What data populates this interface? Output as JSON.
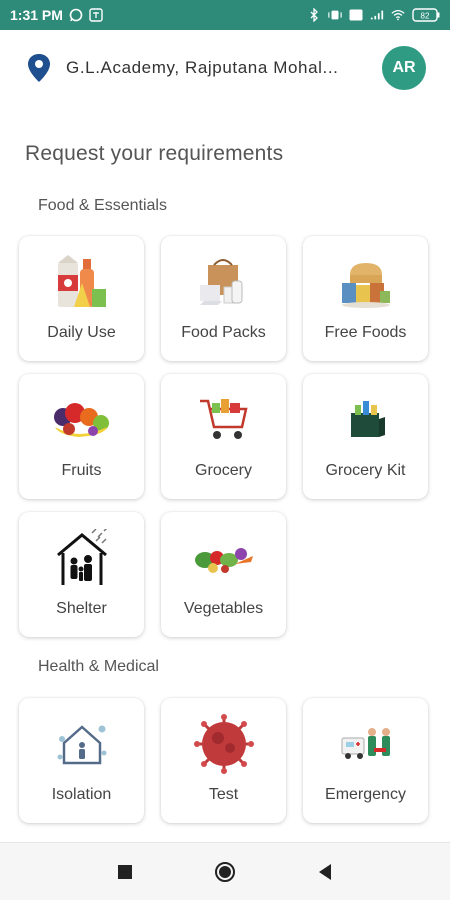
{
  "status": {
    "time": "1:31 PM",
    "battery": "82"
  },
  "header": {
    "location": "G.L.Academy, Rajputana Mohal...",
    "avatar_initials": "AR"
  },
  "page": {
    "title": "Request your requirements"
  },
  "sections": [
    {
      "label": "Food & Essentials",
      "items": [
        {
          "label": "Daily Use",
          "icon": "daily-use-icon"
        },
        {
          "label": "Food Packs",
          "icon": "food-packs-icon"
        },
        {
          "label": "Free Foods",
          "icon": "free-foods-icon"
        },
        {
          "label": "Fruits",
          "icon": "fruits-icon"
        },
        {
          "label": "Grocery",
          "icon": "grocery-icon"
        },
        {
          "label": "Grocery Kit",
          "icon": "grocery-kit-icon"
        },
        {
          "label": "Shelter",
          "icon": "shelter-icon"
        },
        {
          "label": "Vegetables",
          "icon": "vegetables-icon"
        }
      ]
    },
    {
      "label": "Health & Medical",
      "items": [
        {
          "label": "Isolation",
          "icon": "isolation-icon"
        },
        {
          "label": "Test",
          "icon": "test-icon"
        },
        {
          "label": "Emergency",
          "icon": "emergency-icon"
        }
      ]
    }
  ],
  "colors": {
    "status_bar": "#2e8b7a",
    "accent": "#2e9b82",
    "location_pin": "#1f4f8f"
  }
}
